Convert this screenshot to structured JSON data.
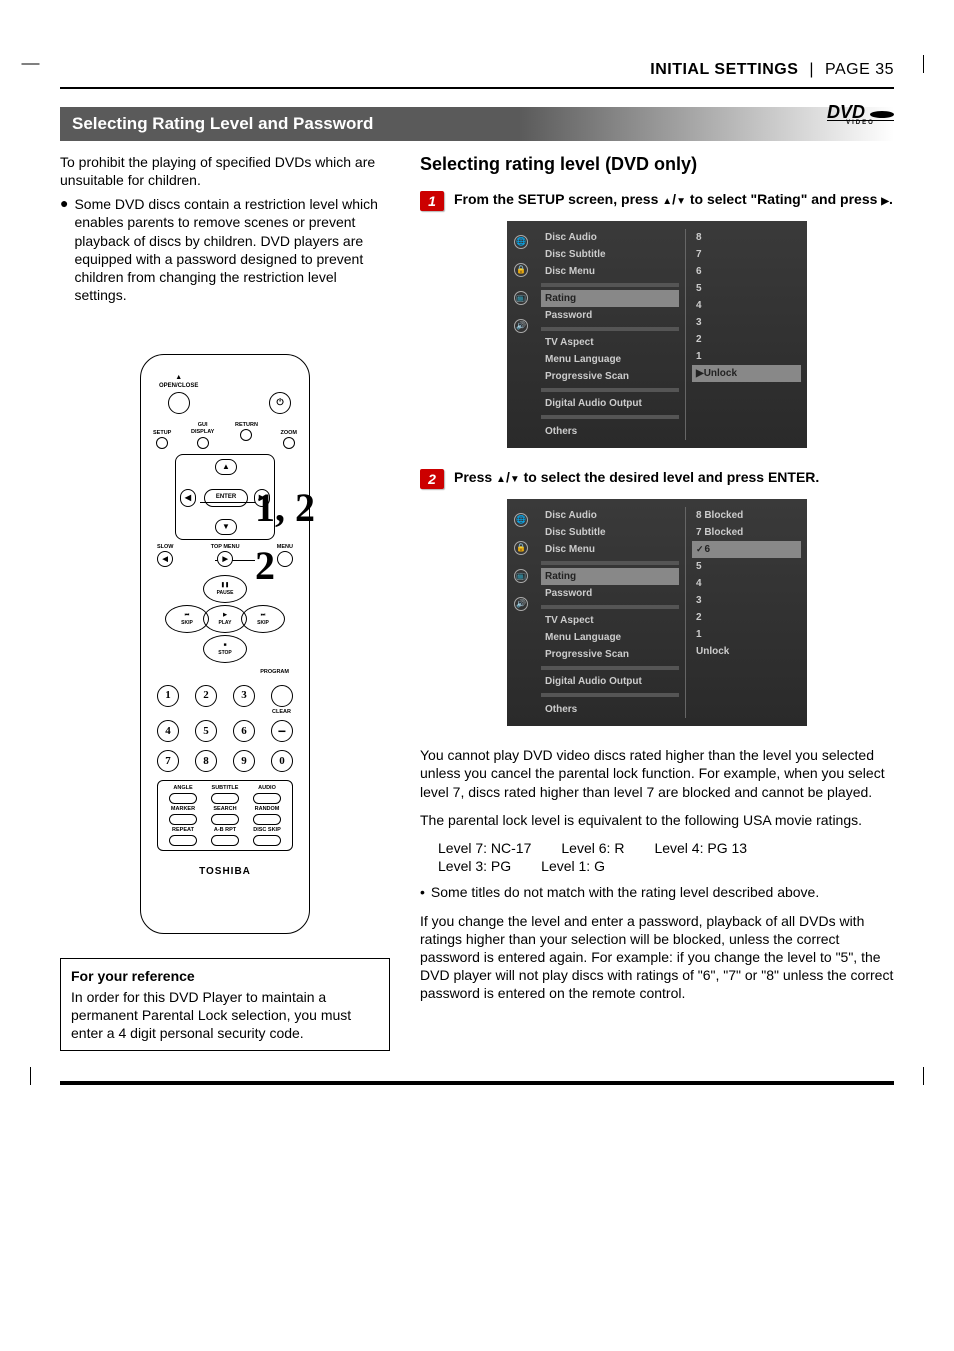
{
  "header": {
    "section": "INITIAL SETTINGS",
    "page_label": "PAGE 35"
  },
  "title_bar": "Selecting Rating Level and Password",
  "dvd_logo": {
    "top": "DVD",
    "bottom": "VIDEO"
  },
  "left": {
    "intro": "To prohibit the playing of specified DVDs which are unsuitable for children.",
    "bullet": "Some DVD discs contain a restriction level which enables parents to remove scenes or prevent playback of discs by children. DVD players are equipped with a password designed to prevent children from changing the restriction level settings.",
    "callout1": "1, 2",
    "callout2": "2",
    "ref_title": "For your reference",
    "ref_body": "In order for this DVD Player to maintain a permanent Parental Lock selection, you must enter a 4 digit personal security code."
  },
  "right": {
    "subhead": "Selecting rating level (DVD only)",
    "step1": {
      "num": "1",
      "text_a": "From the SETUP screen, press ",
      "text_b": " to select \"Rating\" and press ",
      "text_c": "."
    },
    "step2": {
      "num": "2",
      "text_a": "Press ",
      "text_b": " to select the desired level and press ENTER."
    },
    "menu_labels": [
      "Disc Audio",
      "Disc Subtitle",
      "Disc Menu",
      "Rating",
      "Password",
      "TV Aspect",
      "Menu Language",
      "Progressive Scan",
      "Digital Audio Output"
    ],
    "menu_others": "Others",
    "menu1_values": [
      "8",
      "7",
      "6",
      "5",
      "4",
      "3",
      "2",
      "1",
      "▶Unlock"
    ],
    "menu1_hl_label_index": 3,
    "menu1_hl_value_index": 8,
    "menu2_values": [
      "8  Blocked",
      "7  Blocked",
      "6",
      "5",
      "4",
      "3",
      "2",
      "1",
      "Unlock"
    ],
    "menu2_check_index": 2,
    "menu2_hl_label_index": 3,
    "menu2_hl_value_index": 2,
    "para1": "You cannot play DVD video discs rated higher than the level you selected unless you cancel the parental lock function. For example, when you select level 7, discs rated higher than level 7 are blocked and cannot be played.",
    "para2": "The parental lock level is equivalent to the following USA movie ratings.",
    "ratings": [
      [
        "Level 7: NC-17",
        "Level 6: R",
        "Level 4: PG 13"
      ],
      [
        "Level 3: PG",
        "Level 1: G",
        ""
      ]
    ],
    "note": "Some titles do not match with the rating level described above.",
    "para3": "If you change the level and enter a password, playback of all DVDs with ratings higher than your selection will be blocked, unless the correct password is entered again. For example: if you change the level to \"5\", the DVD player will not play discs with ratings of \"6\", \"7\" or \"8\" unless the correct password is entered on the remote control."
  },
  "remote": {
    "open_close": "OPEN/CLOSE",
    "setup": "SETUP",
    "gui_display": "GUI\nDISPLAY",
    "return": "RETURN",
    "zoom": "ZOOM",
    "enter": "ENTER",
    "slow": "SLOW",
    "top_menu": "TOP MENU",
    "menu": "MENU",
    "pause": "PAUSE",
    "skip_prev": "SKIP",
    "play": "PLAY",
    "skip_next": "SKIP",
    "stop": "STOP",
    "program": "PROGRAM",
    "clear": "CLEAR",
    "numbers": [
      "1",
      "2",
      "3",
      "4",
      "5",
      "6",
      "7",
      "8",
      "9",
      "0"
    ],
    "aux": [
      "ANGLE",
      "SUBTITLE",
      "AUDIO",
      "MARKER",
      "SEARCH",
      "RANDOM",
      "REPEAT",
      "A-B RPT",
      "DISC SKIP"
    ],
    "brand": "TOSHIBA"
  }
}
